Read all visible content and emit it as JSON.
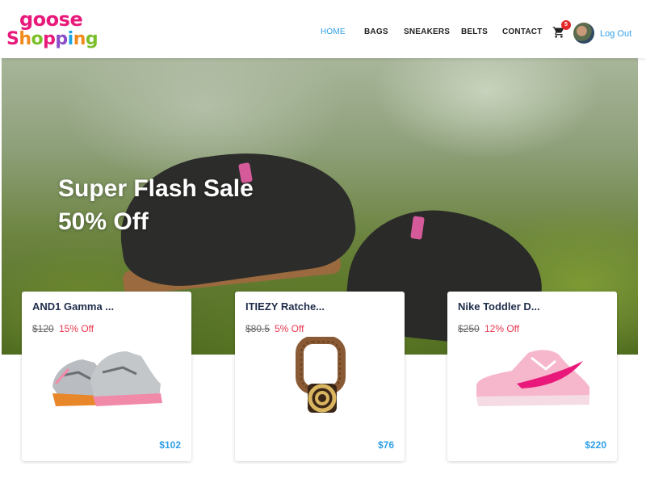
{
  "brand": {
    "line1": "goose",
    "line2": [
      "S",
      "h",
      "o",
      "p",
      "p",
      "i",
      "n",
      "g"
    ]
  },
  "nav": {
    "items": [
      {
        "label": "HOME",
        "active": true
      },
      {
        "label": "BAGS",
        "active": false
      },
      {
        "label": "SNEAKERS",
        "active": false
      },
      {
        "label": "BELTS",
        "active": false
      },
      {
        "label": "CONTACT",
        "active": false
      }
    ],
    "cart_count": "5",
    "logout_label": "Log Out"
  },
  "hero": {
    "line1": "Super Flash Sale",
    "line2": "50% Off"
  },
  "products": [
    {
      "name": "AND1 Gamma ...",
      "old_price": "$120",
      "discount": "15% Off",
      "price": "$102",
      "icon": "sneaker-gray-orange-image"
    },
    {
      "name": "ITIEZY Ratche...",
      "old_price": "$80.5",
      "discount": "5% Off",
      "price": "$76",
      "icon": "brown-belt-image"
    },
    {
      "name": "Nike Toddler D...",
      "old_price": "$250",
      "discount": "12% Off",
      "price": "$220",
      "icon": "pink-sneaker-image"
    }
  ],
  "colors": {
    "accent": "#2f9fe8",
    "brand_pink": "#e8197a",
    "discount": "#e8374f",
    "badge": "#e5262b"
  }
}
